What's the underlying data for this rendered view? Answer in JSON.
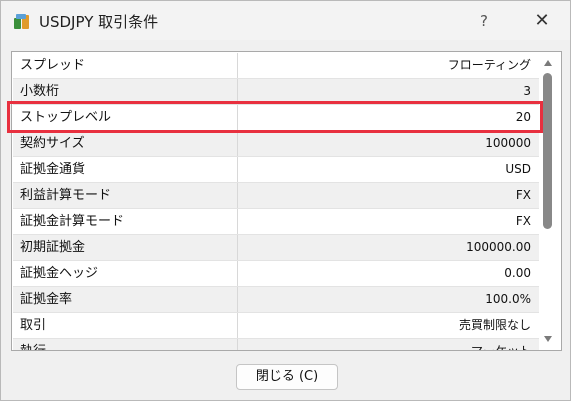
{
  "window": {
    "title": "USDJPY 取引条件",
    "help_label": "?",
    "close_glyph": "✕"
  },
  "table": {
    "rows": [
      {
        "key": "スプレッド",
        "value": "フローティング"
      },
      {
        "key": "小数桁",
        "value": "3"
      },
      {
        "key": "ストップレベル",
        "value": "20"
      },
      {
        "key": "契約サイズ",
        "value": "100000"
      },
      {
        "key": "証拠金通貨",
        "value": "USD"
      },
      {
        "key": "利益計算モード",
        "value": "FX"
      },
      {
        "key": "証拠金計算モード",
        "value": "FX"
      },
      {
        "key": "初期証拠金",
        "value": "100000.00"
      },
      {
        "key": "証拠金ヘッジ",
        "value": "0.00"
      },
      {
        "key": "証拠金率",
        "value": "100.0%"
      },
      {
        "key": "取引",
        "value": "売買制限なし"
      },
      {
        "key": "執行",
        "value": "マーケット"
      }
    ],
    "highlighted_row": 2,
    "highlight_color": "#e8303f"
  },
  "footer": {
    "close_button_label": "閉じる (C)"
  }
}
